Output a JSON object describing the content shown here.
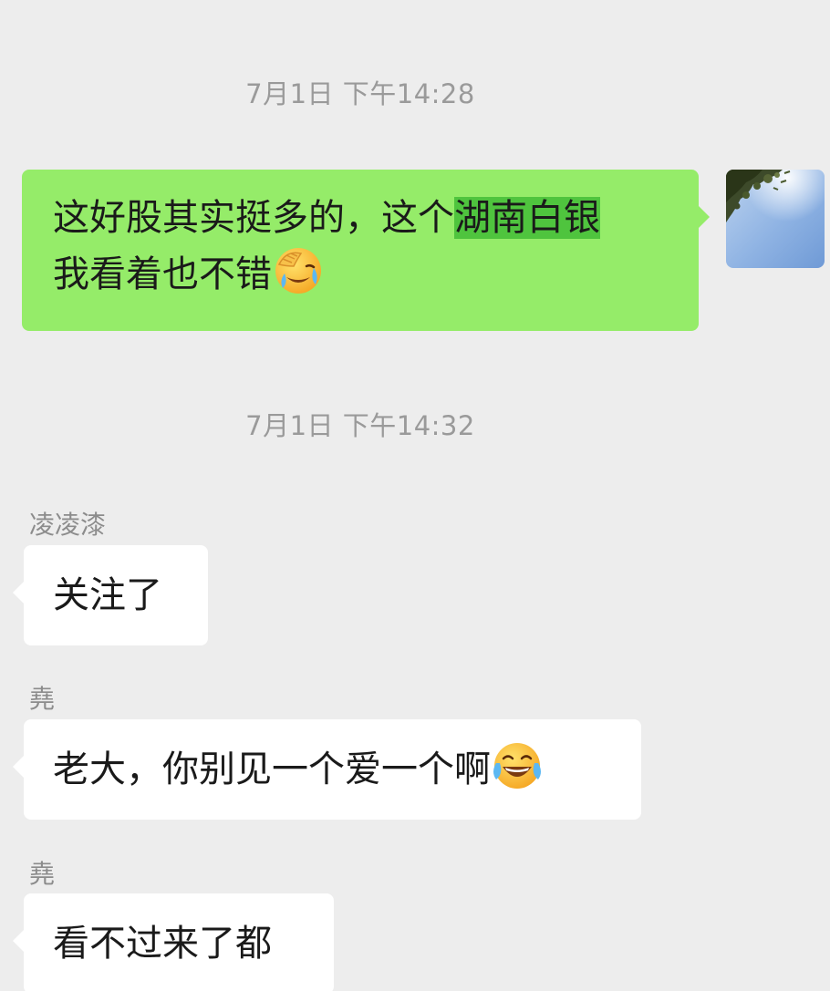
{
  "messages": [
    {
      "timestamp": "7月1日 下午14:28",
      "text_line1_before": "这好股其实挺多的，这个",
      "text_line1_highlight": "湖南白银",
      "text_line2": "我看着也不错",
      "emoji": "facepalm-laughing-emoji"
    },
    {
      "timestamp": "7月1日 下午14:32",
      "sender": "凌凌漆",
      "text": "关注了"
    },
    {
      "sender": "堯",
      "text": "老大，你别见一个爱一个啊",
      "emoji": "tears-of-joy-emoji"
    },
    {
      "sender": "堯",
      "text": "看不过来了都"
    }
  ],
  "colors": {
    "background": "#ededed",
    "outgoing_bubble": "#95ec69",
    "highlight": "#4fc43e",
    "incoming_bubble": "#ffffff",
    "timestamp_text": "#9a9a9a",
    "sender_name": "#8c8c8c"
  }
}
